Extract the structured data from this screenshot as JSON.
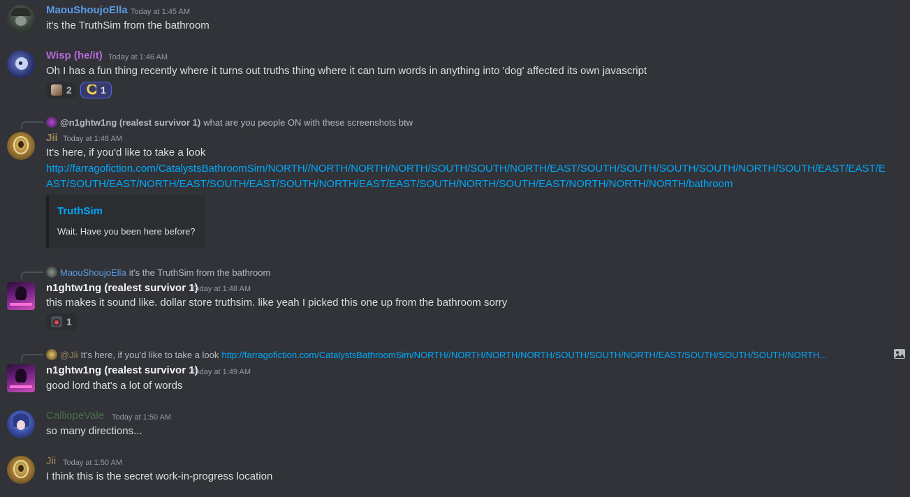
{
  "messages": [
    {
      "username": "MaouShoujoElla",
      "timestamp": "Today at 1:45 AM",
      "text": "it's the TruthSim from the bathroom"
    },
    {
      "username": "Wisp (he/it)",
      "timestamp": "Today at 1:46 AM",
      "text": "Oh I has a fun thing recently where it turns out truths thing where it can turn words in anything into 'dog' affected its own javascript",
      "reactions": [
        {
          "emoji": "dog-emoji",
          "count": "2"
        },
        {
          "emoji": "moon-emoji",
          "count": "1"
        }
      ]
    },
    {
      "reply": {
        "author": "@n1ghtw1ng (realest survivor 1)",
        "text": "what are you people ON with these screenshots btw"
      },
      "username": "Jii",
      "timestamp": "Today at 1:48 AM",
      "text": "It's here, if you'd like to take a look",
      "link_line1": "http://farragofiction.com/CatalystsBathroomSim/NORTH//NORTH/NORTH/NORTH/SOUTH/SOUTH/NORTH/EAST/SOUTH/SOUTH/SOUTH/SOUTH/NORTH/SOUTH/EAST/EAST/E",
      "link_line2": "AST/SOUTH/EAST/NORTH/EAST/SOUTH/EAST/SOUTH/NORTH/EAST/EAST/SOUTH/NORTH/SOUTH/EAST/NORTH/NORTH/NORTH/bathroom",
      "embed": {
        "title": "TruthSim",
        "description": "Wait. Have you been here before?"
      }
    },
    {
      "reply": {
        "author": "MaouShoujoElla",
        "text": "it's the TruthSim from the bathroom"
      },
      "username": "n1ghtw1ng (realest survivor 1)",
      "timestamp": "Today at 1:48 AM",
      "text": "this makes it sound like. dollar store truthsim. like yeah I picked this one up from the bathroom sorry",
      "reactions": [
        {
          "emoji": "skull-emoji",
          "count": "1"
        }
      ]
    },
    {
      "reply": {
        "author": "@Jii",
        "text": "It's here, if you'd like to take a look",
        "link": "http://farragofiction.com/CatalystsBathroomSim/NORTH//NORTH/NORTH/NORTH/SOUTH/SOUTH/NORTH/EAST/SOUTH/SOUTH/SOUTH/NORTH..."
      },
      "username": "n1ghtw1ng (realest survivor 1)",
      "timestamp": "Today at 1:49 AM",
      "text": "good lord that's a lot of words"
    },
    {
      "username": "CalliopeVale",
      "timestamp": "Today at 1:50 AM",
      "text": "so many directions..."
    },
    {
      "username": "Jii",
      "timestamp": "Today at 1:50 AM",
      "text": "I think this is the secret work-in-progress location"
    }
  ],
  "colors": {
    "background": "#313338",
    "maou": "#5b9ce6",
    "wisp": "#b768d9",
    "jii": "#a08a5c",
    "nightwing": "#f2f3f5",
    "calliope": "#4a6b4a",
    "link": "#00a8fc"
  },
  "icons": {
    "reply_attachment": "image-icon"
  }
}
